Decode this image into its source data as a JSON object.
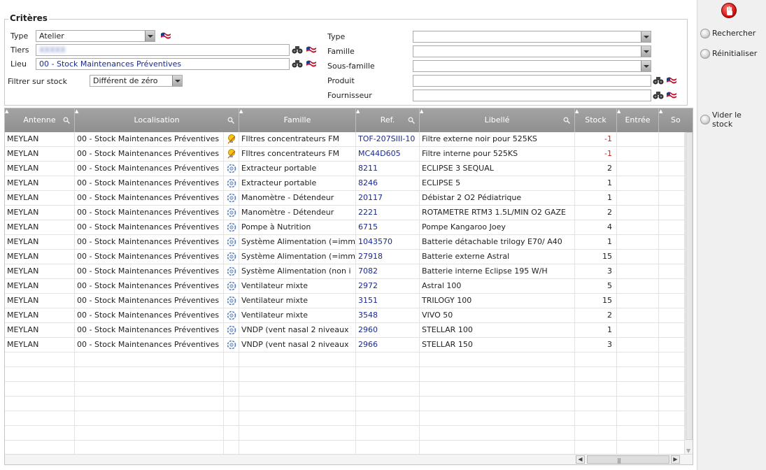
{
  "criteria": {
    "legend": "Critères",
    "type_label": "Type",
    "type_value": "Atelier",
    "tiers_label": "Tiers",
    "tiers_value": "XXXXX",
    "lieu_label": "Lieu",
    "lieu_value": "00 - Stock Maintenances Préventives",
    "filter_label": "Filtrer sur stock",
    "filter_value": "Différent de zéro",
    "right": {
      "type_label": "Type",
      "famille_label": "Famille",
      "sousfamille_label": "Sous-famille",
      "produit_label": "Produit",
      "fournisseur_label": "Fournisseur"
    }
  },
  "side": {
    "rechercher": "Rechercher",
    "reinitialiser": "Réinitialiser",
    "vider_line1": "Vider le",
    "vider_line2": "stock"
  },
  "grid": {
    "headers": {
      "antenne": "Antenne",
      "localisation": "Localisation",
      "famille": "Famille",
      "ref": "Ref.",
      "libelle": "Libellé",
      "stock": "Stock",
      "entree": "Entrée",
      "sortie": "So"
    },
    "rows": [
      {
        "antenne": "MEYLAN",
        "localisation": "00 - Stock Maintenances Préventives",
        "icon": "bulb",
        "famille": "FIltres concentrateurs FM",
        "ref": "TOF-207SIII-10",
        "libelle": "Filtre externe noir pour 525KS",
        "stock": "-1"
      },
      {
        "antenne": "MEYLAN",
        "localisation": "00 - Stock Maintenances Préventives",
        "icon": "bulb",
        "famille": "FIltres concentrateurs FM",
        "ref": "MC44D605",
        "libelle": "Filtre interne pour 525KS",
        "stock": "-1"
      },
      {
        "antenne": "MEYLAN",
        "localisation": "00 - Stock Maintenances Préventives",
        "icon": "gear",
        "famille": "Extracteur portable",
        "ref": "8211",
        "libelle": "ECLIPSE 3  SEQUAL",
        "stock": "2"
      },
      {
        "antenne": "MEYLAN",
        "localisation": "00 - Stock Maintenances Préventives",
        "icon": "gear",
        "famille": "Extracteur portable",
        "ref": "8246",
        "libelle": "ECLIPSE 5",
        "stock": "1"
      },
      {
        "antenne": "MEYLAN",
        "localisation": "00 - Stock Maintenances Préventives",
        "icon": "gear",
        "famille": "Manomètre - Détendeur",
        "ref": "20117",
        "libelle": "Débistar 2 O2 Pédiatrique",
        "stock": "1"
      },
      {
        "antenne": "MEYLAN",
        "localisation": "00 - Stock Maintenances Préventives",
        "icon": "gear",
        "famille": "Manomètre - Détendeur",
        "ref": "2221",
        "libelle": "ROTAMETRE RTM3 1.5L/MIN O2 GAZE",
        "stock": "2"
      },
      {
        "antenne": "MEYLAN",
        "localisation": "00 - Stock Maintenances Préventives",
        "icon": "gear",
        "famille": "Pompe à Nutrition",
        "ref": "6715",
        "libelle": "Pompe Kangaroo Joey",
        "stock": "4"
      },
      {
        "antenne": "MEYLAN",
        "localisation": "00 - Stock Maintenances Préventives",
        "icon": "gear",
        "famille": "Système Alimentation (=imm",
        "ref": "1043570",
        "libelle": "Batterie détachable trilogy  E70/ A40",
        "stock": "1"
      },
      {
        "antenne": "MEYLAN",
        "localisation": "00 - Stock Maintenances Préventives",
        "icon": "gear",
        "famille": "Système Alimentation (=imm",
        "ref": "27918",
        "libelle": "Batterie externe Astral",
        "stock": "15"
      },
      {
        "antenne": "MEYLAN",
        "localisation": "00 - Stock Maintenances Préventives",
        "icon": "gear",
        "famille": "Système Alimentation (non i",
        "ref": "7082",
        "libelle": "Batterie interne Eclipse 195 W/H",
        "stock": "3"
      },
      {
        "antenne": "MEYLAN",
        "localisation": "00 - Stock Maintenances Préventives",
        "icon": "gear",
        "famille": "Ventilateur mixte",
        "ref": "2972",
        "libelle": "Astral 100",
        "stock": "5"
      },
      {
        "antenne": "MEYLAN",
        "localisation": "00 - Stock Maintenances Préventives",
        "icon": "gear",
        "famille": "Ventilateur mixte",
        "ref": "3151",
        "libelle": "TRILOGY 100",
        "stock": "15"
      },
      {
        "antenne": "MEYLAN",
        "localisation": "00 - Stock Maintenances Préventives",
        "icon": "gear",
        "famille": "Ventilateur mixte",
        "ref": "3548",
        "libelle": "VIVO 50",
        "stock": "2"
      },
      {
        "antenne": "MEYLAN",
        "localisation": "00 - Stock Maintenances Préventives",
        "icon": "gear",
        "famille": "VNDP (vent nasal 2 niveaux",
        "ref": "2960",
        "libelle": "STELLAR 100",
        "stock": "1"
      },
      {
        "antenne": "MEYLAN",
        "localisation": "00 - Stock Maintenances Préventives",
        "icon": "gear",
        "famille": "VNDP (vent nasal 2 niveaux",
        "ref": "2966",
        "libelle": "STELLAR 150",
        "stock": "3"
      }
    ],
    "empty_rows": 7
  },
  "colors": {
    "header_bg": "#999999",
    "link_blue": "#1a2a8c",
    "negative_red": "#d11a1a"
  }
}
